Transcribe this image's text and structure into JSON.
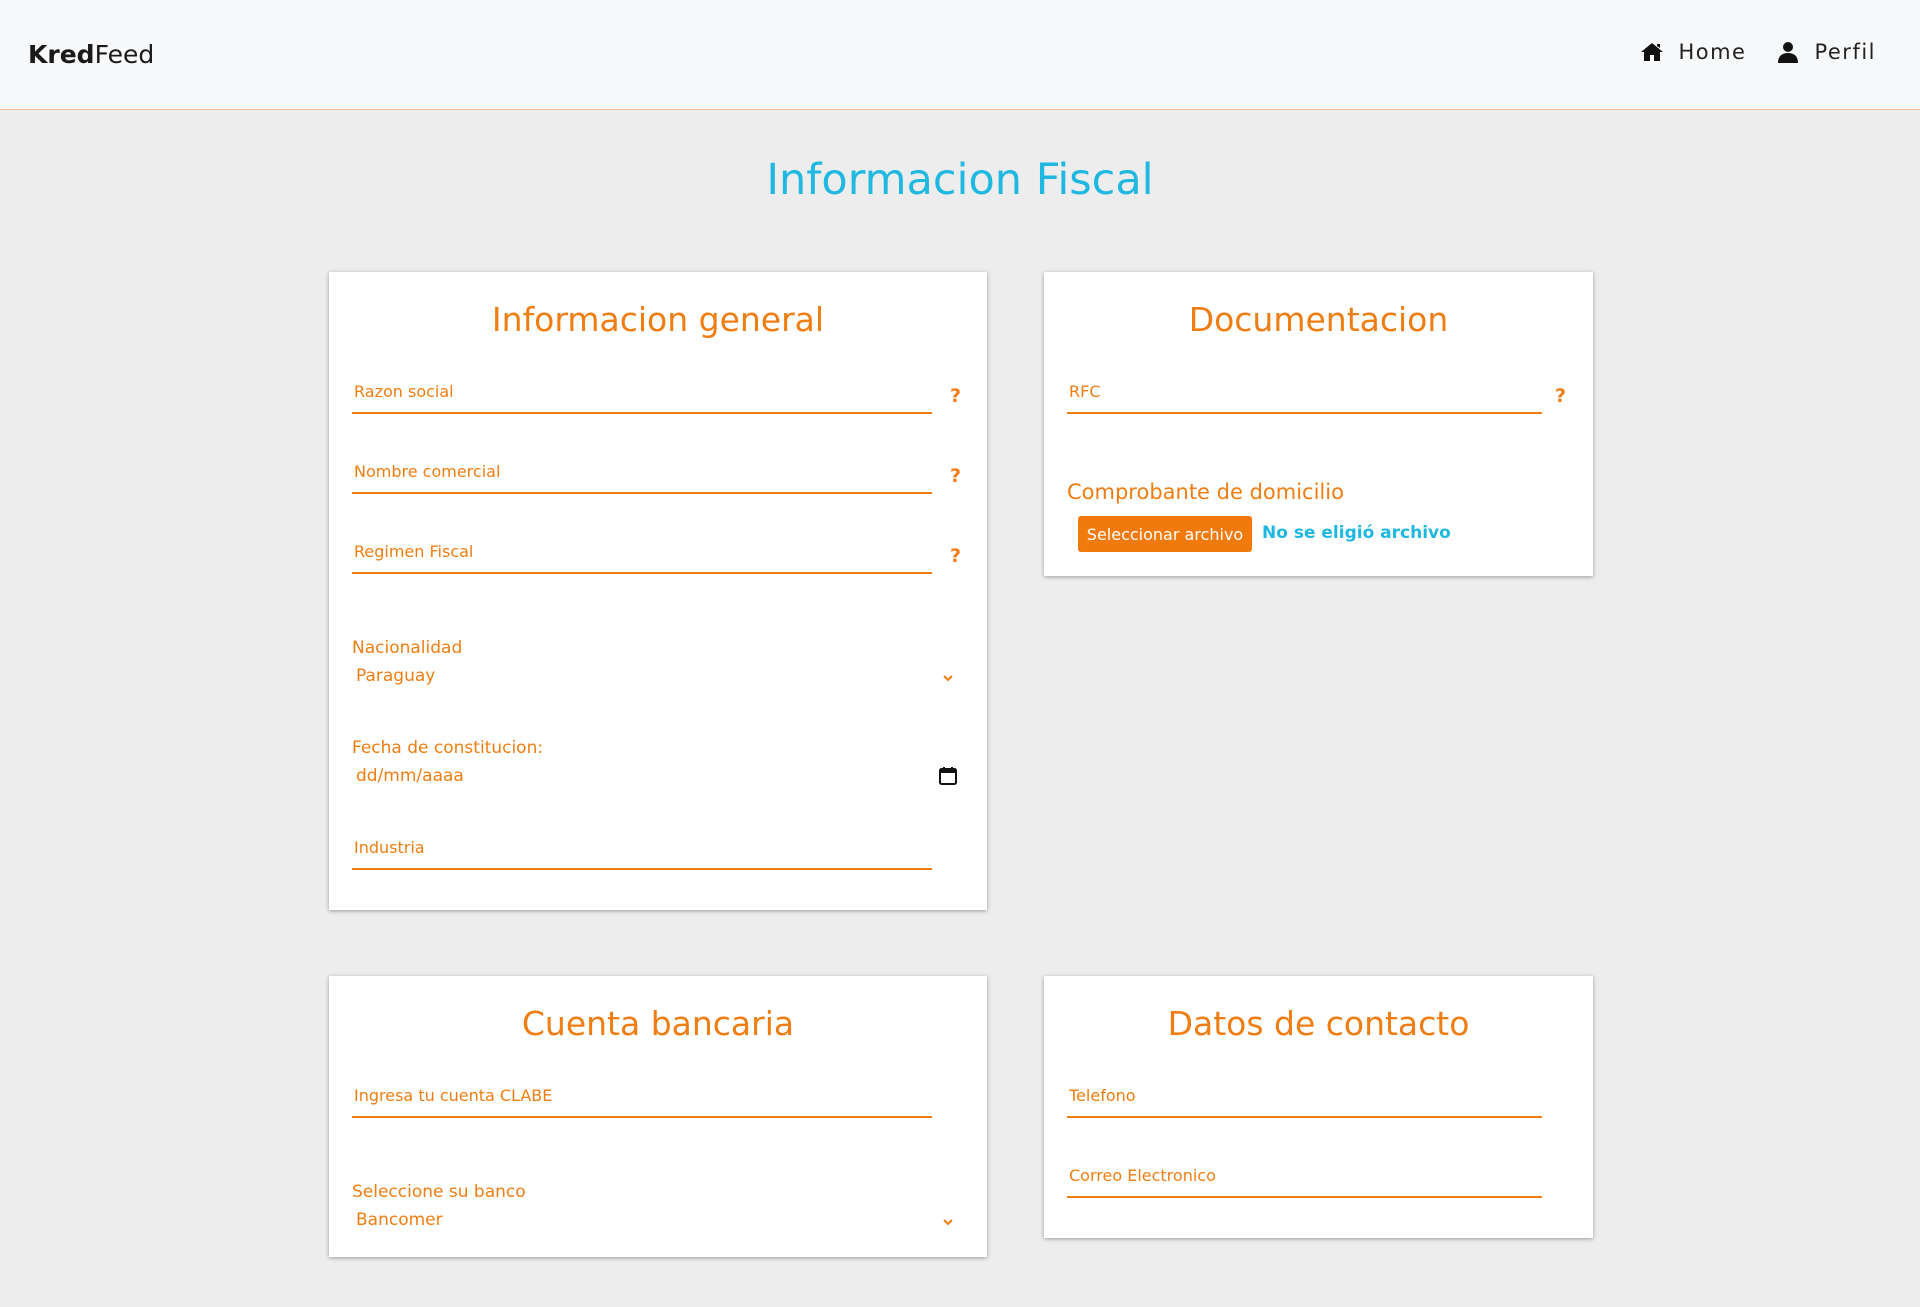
{
  "navbar": {
    "logo_kred": "Kred",
    "logo_feed": "Feed",
    "home_label": "Home",
    "profile_label": "Perfil"
  },
  "page_title": "Informacion Fiscal",
  "general": {
    "title": "Informacion general",
    "razon_social_placeholder": "Razon social",
    "nombre_comercial_placeholder": "Nombre comercial",
    "regimen_fiscal_placeholder": "Regimen Fiscal",
    "nacionalidad_label": "Nacionalidad",
    "nacionalidad_value": "Paraguay",
    "fecha_label": "Fecha de constitucion:",
    "fecha_placeholder": "dd/mm/aaaa",
    "industria_placeholder": "Industria",
    "help_glyph": "?"
  },
  "documentacion": {
    "title": "Documentacion",
    "rfc_placeholder": "RFC",
    "comprobante_label": "Comprobante de domicilio",
    "file_button_label": "Seleccionar archivo",
    "file_status": "No se eligió archivo",
    "help_glyph": "?"
  },
  "cuenta": {
    "title": "Cuenta bancaria",
    "clabe_placeholder": "Ingresa tu cuenta CLABE",
    "banco_label": "Seleccione su banco",
    "banco_value": "Bancomer"
  },
  "contacto": {
    "title": "Datos de contacto",
    "telefono_placeholder": "Telefono",
    "correo_placeholder": "Correo Electronico"
  },
  "colors": {
    "accent": "#f07d12",
    "title_blue": "#1eb8e0",
    "background": "#ededed"
  }
}
